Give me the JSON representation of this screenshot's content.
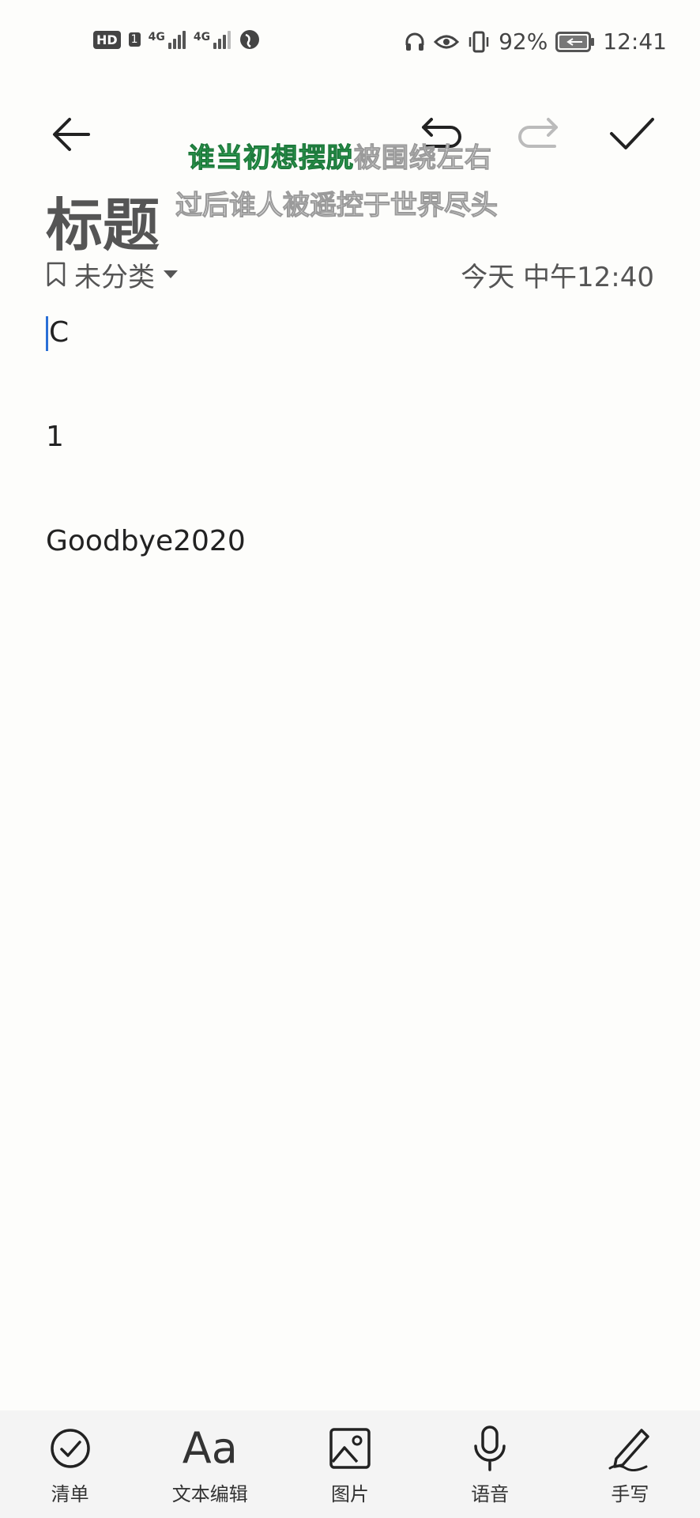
{
  "status_bar": {
    "hd_label": "HD",
    "sim1": "4G",
    "sim2": "4G",
    "battery": "92%",
    "time": "12:41"
  },
  "toolbar": {
    "back_icon": "back-arrow-icon",
    "undo_icon": "undo-icon",
    "redo_icon": "redo-icon",
    "save_icon": "checkmark-icon"
  },
  "lyrics": {
    "line1_sung": "谁当初想摆脱",
    "line1_rest": "被围绕左右",
    "line2": "过后谁人被遥控于世界尽头"
  },
  "note": {
    "title": "标题",
    "category": "未分类",
    "timestamp": "今天 中午12:40",
    "lines": [
      "C",
      "1",
      "Goodbye2020"
    ]
  },
  "bottom_toolbar": {
    "checklist": "清单",
    "text_edit_icon_text": "Aa",
    "text_edit": "文本编辑",
    "image": "图片",
    "voice": "语音",
    "handwriting": "手写"
  }
}
